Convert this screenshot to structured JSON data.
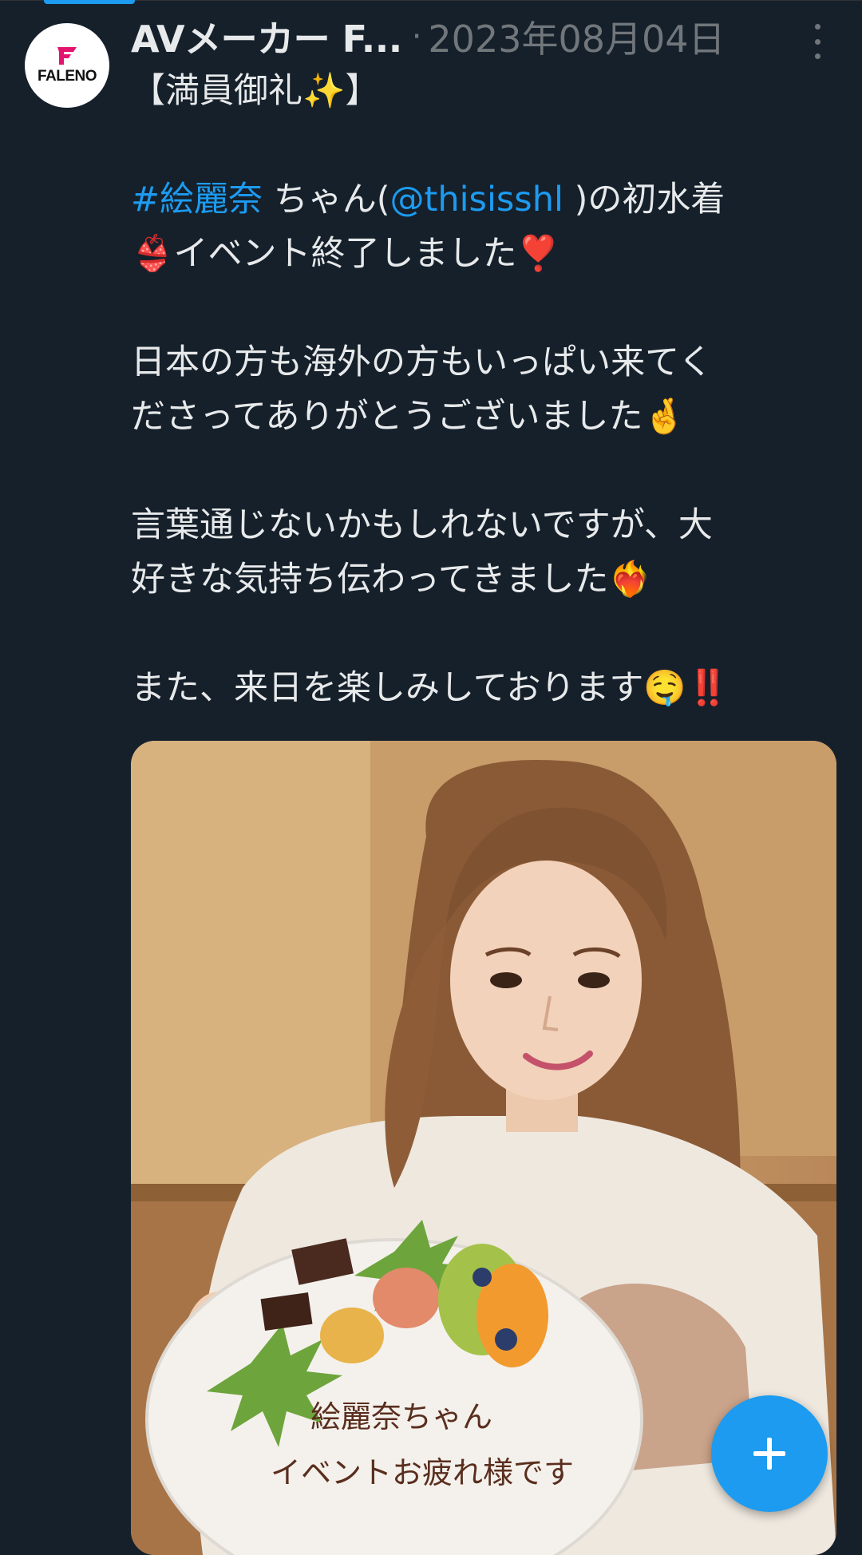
{
  "account": {
    "display_name": "AVメーカー F...",
    "separator": "·",
    "date": "2023年08月04日",
    "avatar_text": "FALENO"
  },
  "tweet": {
    "line1": "【満員御礼✨】",
    "hashtag": "#絵麗奈",
    "line2_mid": " ちゃん(",
    "mention": "@thisisshl",
    "line2_end": " )の初水着",
    "line3": "👙イベント終了しました❣️",
    "line4": "日本の方も海外の方もいっぱい来てく",
    "line5": "ださってありがとうございました🤞",
    "line6": "言葉通じないかもしれないですが、大",
    "line7": "好きな気持ち伝わってきました❤️‍🔥",
    "line8": "また、来日を楽しみしております🤤‼️"
  },
  "media": {
    "plate_text_line1": "絵麗奈ちゃん",
    "plate_text_line2": "イベントお疲れ様です"
  },
  "fab": {
    "icon": "plus-icon"
  },
  "colors": {
    "background": "#15202b",
    "accent": "#1d9bf0",
    "muted": "#71767b",
    "text": "#e7e9ea"
  }
}
